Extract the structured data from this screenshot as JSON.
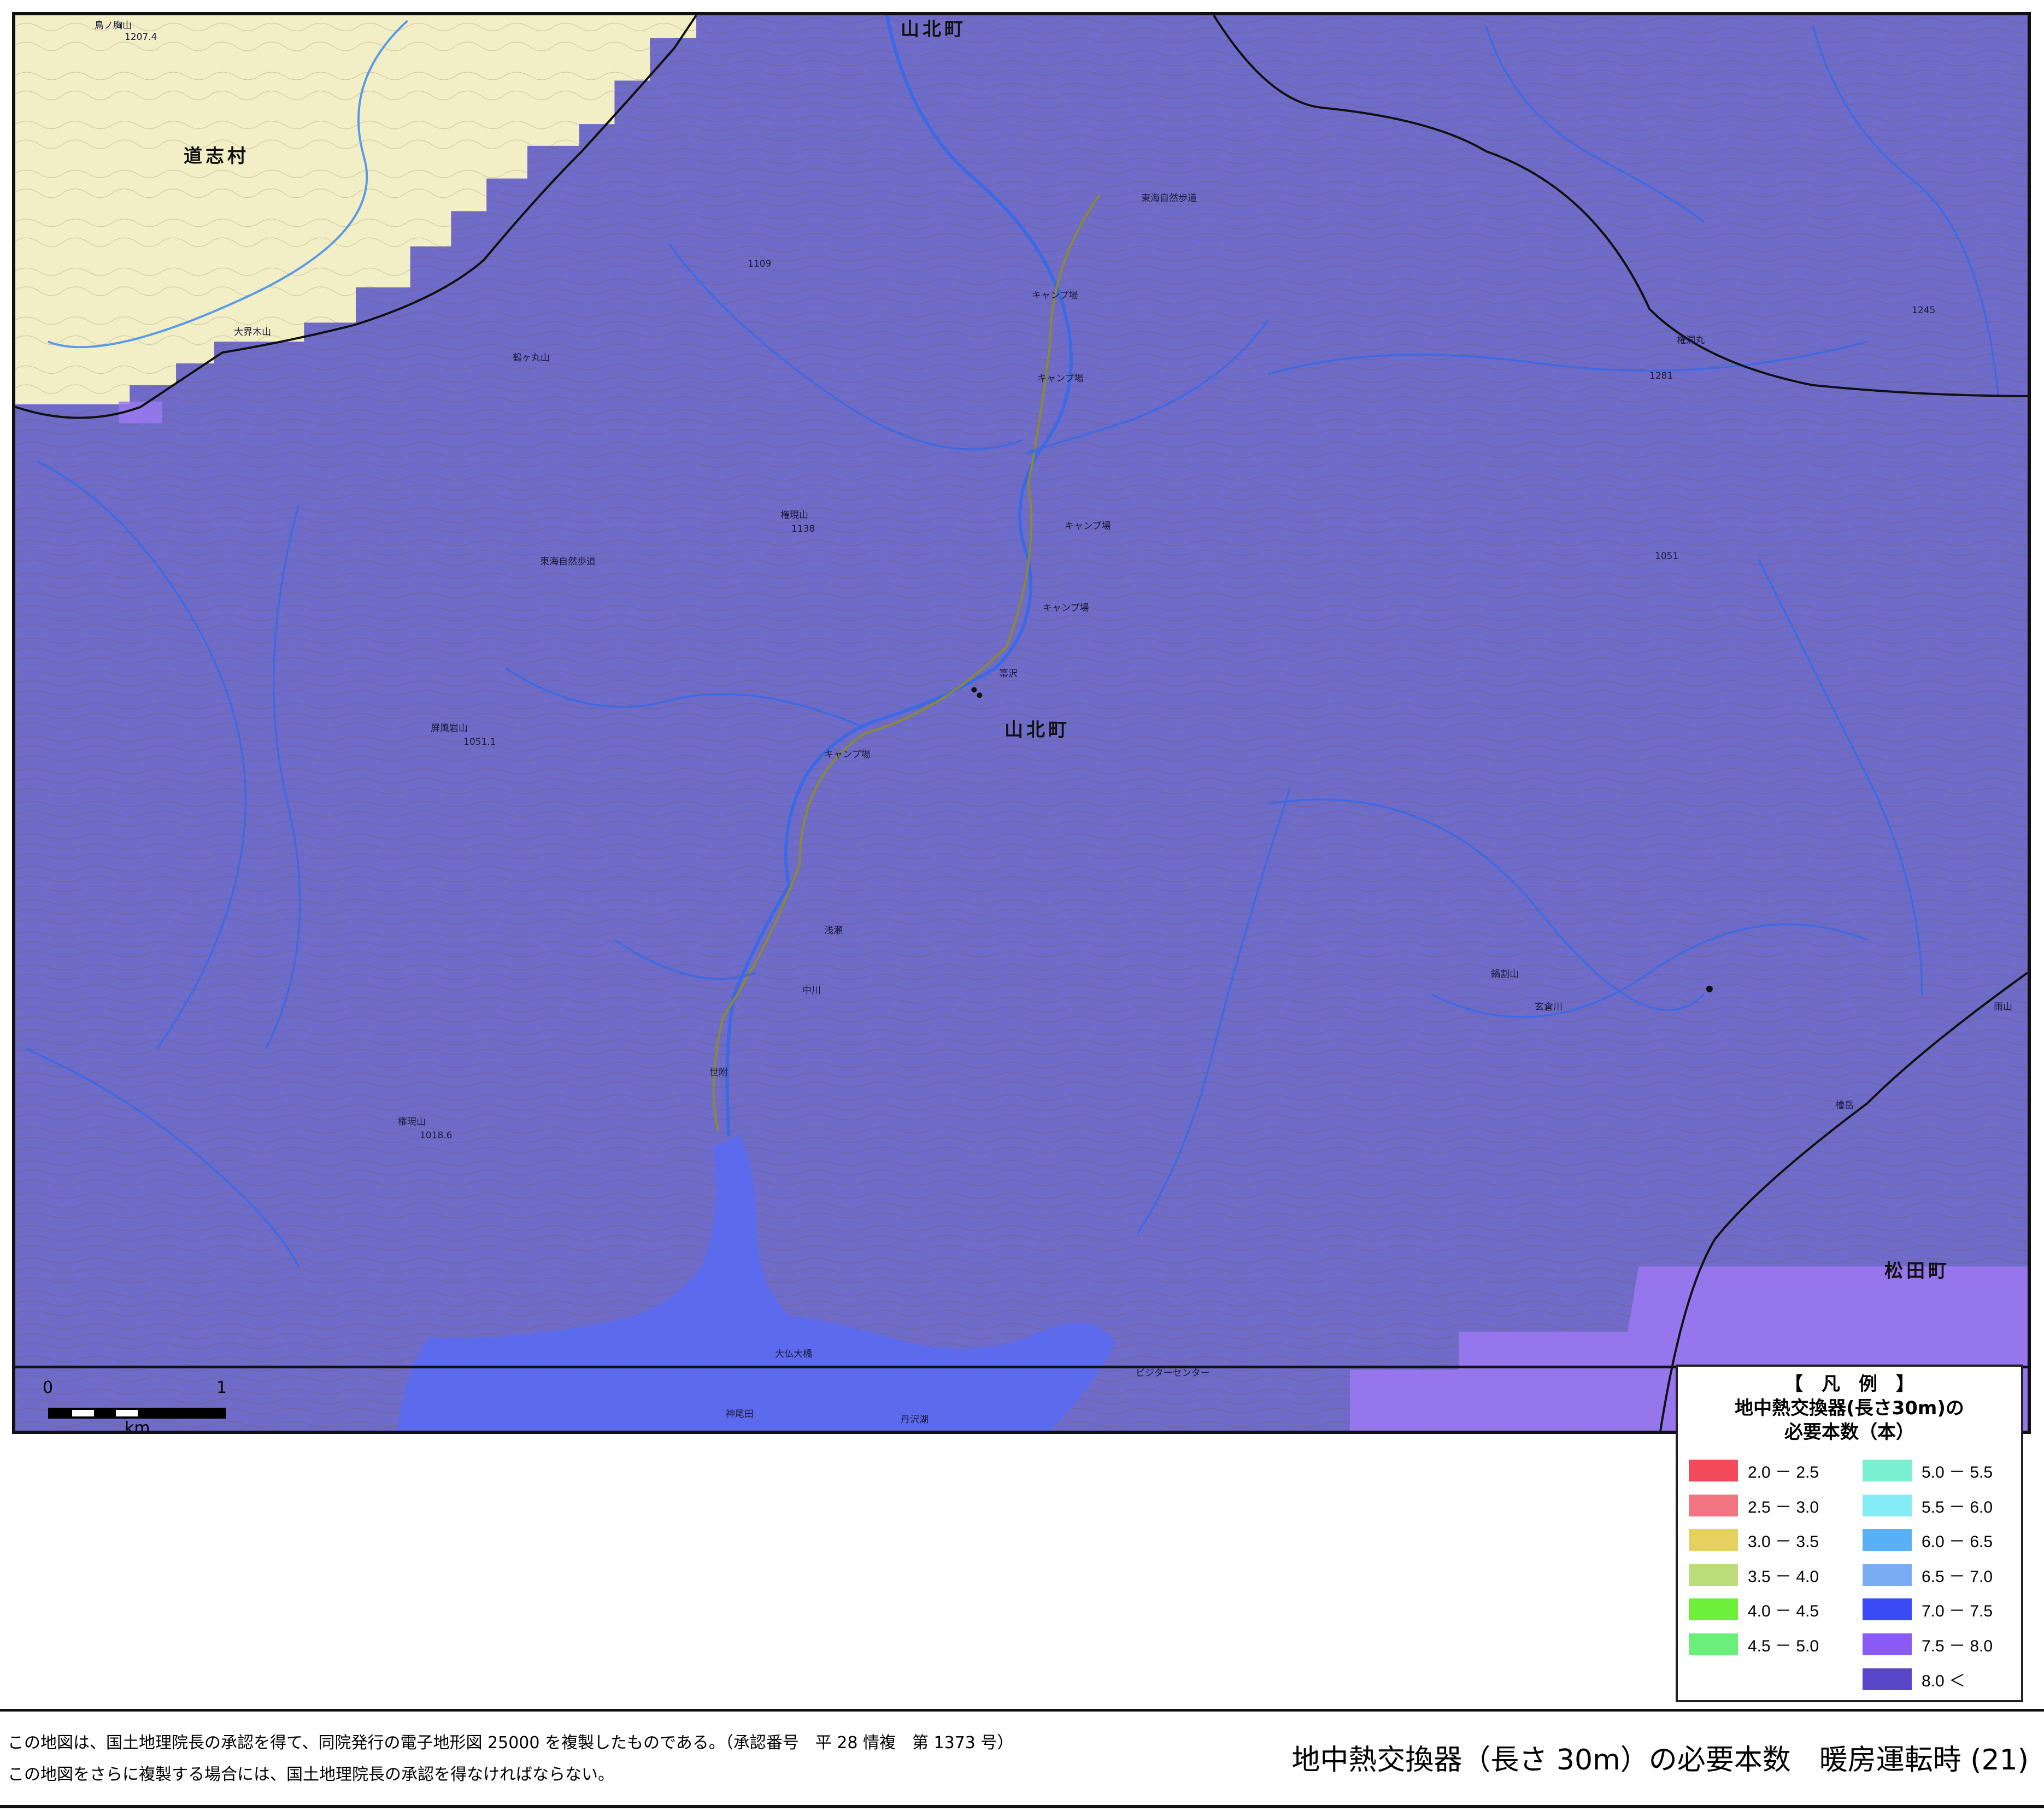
{
  "map": {
    "colors": {
      "main_zone": "#6e6cc8",
      "base_zone": "#f2eec6",
      "zone_7_5_8": "#9a78f0",
      "water": "#5a6cf2",
      "river": "#3a6ae6",
      "contour": "#7a5868",
      "road": "#8a8a30",
      "boundary": "#111111"
    },
    "place_names": {
      "doshi": "道志村",
      "yamakita_top": "山北町",
      "yamakita_center": "山北町",
      "matsuda": "松田町"
    },
    "minor_labels": {
      "m1": "鳥ノ胸山",
      "m2": "大界木山",
      "m3": "鶴ヶ丸山",
      "m4": "権現山",
      "m5": "屏風岩山",
      "m6": "権現山",
      "m7": "キャンプ場",
      "m8": "キャンプ場",
      "m9": "キャンプ場",
      "m10": "キャンプ場",
      "m11": "キャンプ場",
      "m12": "権洞丸",
      "m13": "東海自然歩道",
      "m14": "東海自然歩道",
      "m15": "箒沢",
      "m16": "中川",
      "m17": "浅瀬",
      "m18": "世附",
      "m19": "大仏大橋",
      "m20": "ビジターセンター",
      "m21": "丹沢湖",
      "m22": "神尾田",
      "m23": "鍋割山",
      "m24": "檜岳",
      "m25": "雨山",
      "m26": "玄倉川",
      "m27": "1207.4",
      "m28": "1109",
      "m29": "1051.1",
      "m30": "1018.6",
      "m31": "1051",
      "m32": "1138",
      "m33": "1281",
      "m34": "1245"
    },
    "scale_bar": {
      "start": "0",
      "end": "1",
      "unit": "km"
    }
  },
  "legend": {
    "title_bracket": "【　凡　例　】",
    "title_line1": "地中熱交換器(長さ30m)の",
    "title_line2": "必要本数（本）",
    "items": [
      {
        "label": "2.0 － 2.5",
        "color": "#f24a5a"
      },
      {
        "label": "2.5 － 3.0",
        "color": "#f27480"
      },
      {
        "label": "3.0 － 3.5",
        "color": "#e8d060"
      },
      {
        "label": "3.5 － 4.0",
        "color": "#bcdc7a"
      },
      {
        "label": "4.0 － 4.5",
        "color": "#6ef03a"
      },
      {
        "label": "4.5 － 5.0",
        "color": "#6af07a"
      },
      {
        "label": "5.0 － 5.5",
        "color": "#7af0d0"
      },
      {
        "label": "5.5 － 6.0",
        "color": "#84ecf4"
      },
      {
        "label": "6.0 － 6.5",
        "color": "#5ab0f4"
      },
      {
        "label": "6.5 － 7.0",
        "color": "#7aacf4"
      },
      {
        "label": "7.0 － 7.5",
        "color": "#3a4af4"
      },
      {
        "label": "7.5 － 8.0",
        "color": "#8a5af4"
      },
      {
        "label": "8.0 ＜",
        "color": "#5a46c8"
      }
    ]
  },
  "footer": {
    "note1": "この地図は、国土地理院長の承認を得て、同院発行の電子地形図 25000 を複製したものである。（承認番号　平 28 情複　第 1373 号）",
    "note2": "この地図をさらに複製する場合には、国土地理院長の承認を得なければならない。",
    "title": "地中熱交換器（長さ 30m）の必要本数　暖房運転時 (21)"
  }
}
